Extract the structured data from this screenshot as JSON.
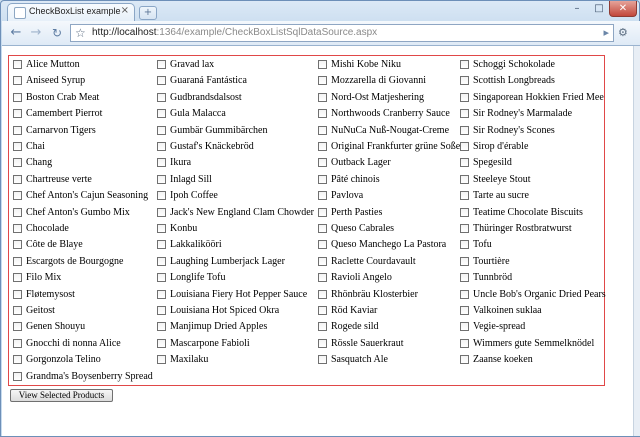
{
  "browser": {
    "tab_title": "CheckBoxList example: ho...",
    "tab_close": "×",
    "new_tab": "+",
    "url_host": "http://localhost",
    "url_path": ":1364/example/CheckBoxListSqlDataSource.aspx",
    "window_controls": {
      "minimize": "–",
      "maximize": "□",
      "close": "✕"
    }
  },
  "checkboxlist": {
    "columns": [
      [
        {
          "label": "Alice Mutton",
          "checked": false
        },
        {
          "label": "Aniseed Syrup",
          "checked": false
        },
        {
          "label": "Boston Crab Meat",
          "checked": false
        },
        {
          "label": "Camembert Pierrot",
          "checked": false
        },
        {
          "label": "Carnarvon Tigers",
          "checked": false
        },
        {
          "label": "Chai",
          "checked": false
        },
        {
          "label": "Chang",
          "checked": false
        },
        {
          "label": "Chartreuse verte",
          "checked": false
        },
        {
          "label": "Chef Anton's Cajun Seasoning",
          "checked": false
        },
        {
          "label": "Chef Anton's Gumbo Mix",
          "checked": false
        },
        {
          "label": "Chocolade",
          "checked": false
        },
        {
          "label": "Côte de Blaye",
          "checked": false
        },
        {
          "label": "Escargots de Bourgogne",
          "checked": false
        },
        {
          "label": "Filo Mix",
          "checked": false
        },
        {
          "label": "Fløtemysost",
          "checked": false
        },
        {
          "label": "Geitost",
          "checked": false
        },
        {
          "label": "Genen Shouyu",
          "checked": false
        },
        {
          "label": "Gnocchi di nonna Alice",
          "checked": false
        },
        {
          "label": "Gorgonzola Telino",
          "checked": false
        },
        {
          "label": "Grandma's Boysenberry Spread",
          "checked": false
        }
      ],
      [
        {
          "label": "Gravad lax",
          "checked": false
        },
        {
          "label": "Guaraná Fantástica",
          "checked": false
        },
        {
          "label": "Gudbrandsdalsost",
          "checked": false
        },
        {
          "label": "Gula Malacca",
          "checked": false
        },
        {
          "label": "Gumbär Gummibärchen",
          "checked": false
        },
        {
          "label": "Gustaf's Knäckebröd",
          "checked": false
        },
        {
          "label": "Ikura",
          "checked": false
        },
        {
          "label": "Inlagd Sill",
          "checked": false
        },
        {
          "label": "Ipoh Coffee",
          "checked": false
        },
        {
          "label": "Jack's New England Clam Chowder",
          "checked": false
        },
        {
          "label": "Konbu",
          "checked": false
        },
        {
          "label": "Lakkalikööri",
          "checked": false
        },
        {
          "label": "Laughing Lumberjack Lager",
          "checked": false
        },
        {
          "label": "Longlife Tofu",
          "checked": false
        },
        {
          "label": "Louisiana Fiery Hot Pepper Sauce",
          "checked": false
        },
        {
          "label": "Louisiana Hot Spiced Okra",
          "checked": false
        },
        {
          "label": "Manjimup Dried Apples",
          "checked": false
        },
        {
          "label": "Mascarpone Fabioli",
          "checked": false
        },
        {
          "label": "Maxilaku",
          "checked": false
        }
      ],
      [
        {
          "label": "Mishi Kobe Niku",
          "checked": false
        },
        {
          "label": "Mozzarella di Giovanni",
          "checked": false
        },
        {
          "label": "Nord-Ost Matjeshering",
          "checked": false
        },
        {
          "label": "Northwoods Cranberry Sauce",
          "checked": false
        },
        {
          "label": "NuNuCa Nuß-Nougat-Creme",
          "checked": false
        },
        {
          "label": "Original Frankfurter grüne Soße",
          "checked": false
        },
        {
          "label": "Outback Lager",
          "checked": false
        },
        {
          "label": "Pâté chinois",
          "checked": false
        },
        {
          "label": "Pavlova",
          "checked": false
        },
        {
          "label": "Perth Pasties",
          "checked": false
        },
        {
          "label": "Queso Cabrales",
          "checked": false
        },
        {
          "label": "Queso Manchego La Pastora",
          "checked": false
        },
        {
          "label": "Raclette Courdavault",
          "checked": false
        },
        {
          "label": "Ravioli Angelo",
          "checked": false
        },
        {
          "label": "Rhönbräu Klosterbier",
          "checked": false
        },
        {
          "label": "Röd Kaviar",
          "checked": false
        },
        {
          "label": "Rogede sild",
          "checked": false
        },
        {
          "label": "Rössle Sauerkraut",
          "checked": false
        },
        {
          "label": "Sasquatch Ale",
          "checked": false
        }
      ],
      [
        {
          "label": "Schoggi Schokolade",
          "checked": false
        },
        {
          "label": "Scottish Longbreads",
          "checked": false
        },
        {
          "label": "Singaporean Hokkien Fried Mee",
          "checked": false
        },
        {
          "label": "Sir Rodney's Marmalade",
          "checked": false
        },
        {
          "label": "Sir Rodney's Scones",
          "checked": false
        },
        {
          "label": "Sirop d'érable",
          "checked": false
        },
        {
          "label": "Spegesild",
          "checked": false
        },
        {
          "label": "Steeleye Stout",
          "checked": false
        },
        {
          "label": "Tarte au sucre",
          "checked": false
        },
        {
          "label": "Teatime Chocolate Biscuits",
          "checked": false
        },
        {
          "label": "Thüringer Rostbratwurst",
          "checked": false
        },
        {
          "label": "Tofu",
          "checked": false
        },
        {
          "label": "Tourtière",
          "checked": false
        },
        {
          "label": "Tunnbröd",
          "checked": false
        },
        {
          "label": "Uncle Bob's Organic Dried Pears",
          "checked": false
        },
        {
          "label": "Valkoinen suklaa",
          "checked": false
        },
        {
          "label": "Vegie-spread",
          "checked": false
        },
        {
          "label": "Wimmers gute Semmelknödel",
          "checked": false
        },
        {
          "label": "Zaanse koeken",
          "checked": false
        }
      ]
    ]
  },
  "submit_button": {
    "label": "View Selected Products"
  },
  "colors": {
    "list_border": "#e04848",
    "page_background": "#ffffff",
    "chrome": "#c7dbee"
  }
}
